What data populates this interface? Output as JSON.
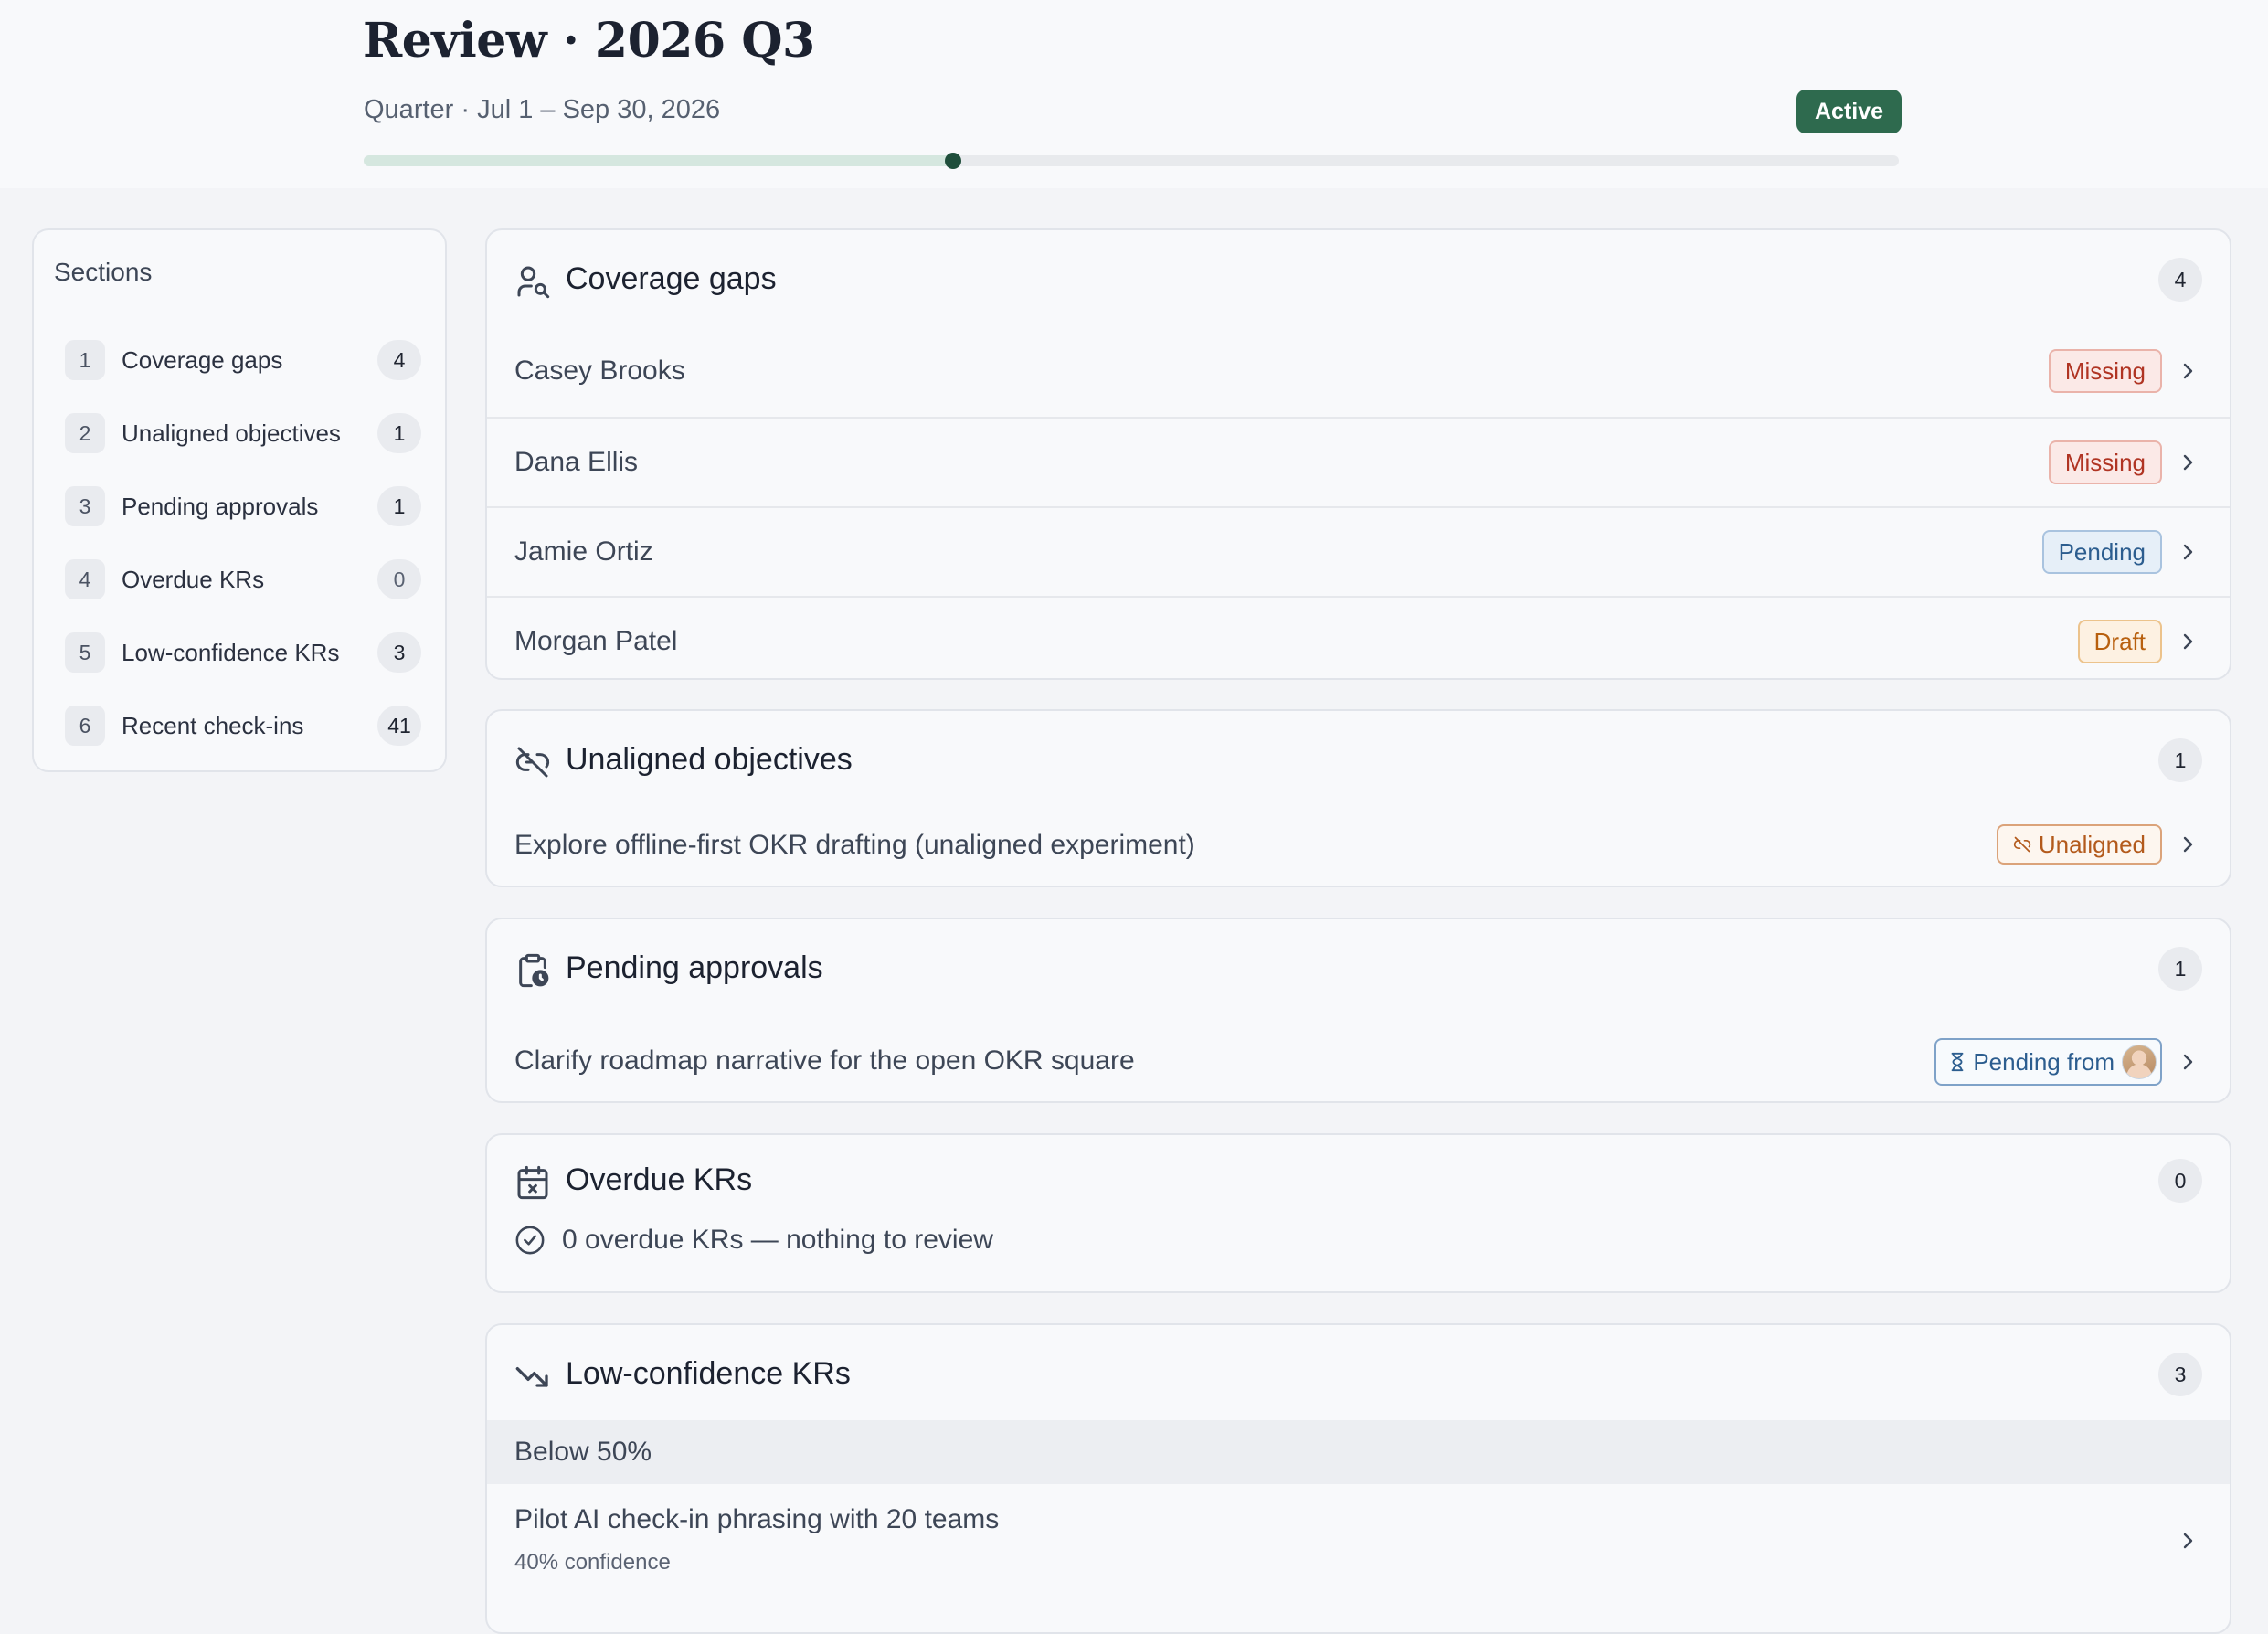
{
  "header": {
    "title": "Review · 2026 Q3",
    "subtitle": "Quarter · Jul 1 – Sep 30, 2026",
    "status": "Active",
    "status_color": "#2e6a4e",
    "progress_fraction": 0.384
  },
  "sidebar": {
    "heading": "Sections",
    "items": [
      {
        "index": "1",
        "label": "Coverage gaps",
        "count": "4"
      },
      {
        "index": "2",
        "label": "Unaligned objectives",
        "count": "1"
      },
      {
        "index": "3",
        "label": "Pending approvals",
        "count": "1"
      },
      {
        "index": "4",
        "label": "Overdue KRs",
        "count": "0"
      },
      {
        "index": "5",
        "label": "Low-confidence KRs",
        "count": "3"
      },
      {
        "index": "6",
        "label": "Recent check-ins",
        "count": "41"
      }
    ]
  },
  "coverage": {
    "title": "Coverage gaps",
    "icon": "user-search-icon",
    "count": "4",
    "rows": [
      {
        "name": "Casey Brooks",
        "status": "Missing"
      },
      {
        "name": "Dana Ellis",
        "status": "Missing"
      },
      {
        "name": "Jamie Ortiz",
        "status": "Pending"
      },
      {
        "name": "Morgan Patel",
        "status": "Draft"
      }
    ]
  },
  "unaligned": {
    "title": "Unaligned objectives",
    "icon": "unlink-icon",
    "count": "1",
    "rows": [
      {
        "name": "Explore offline-first OKR drafting (unaligned experiment)",
        "status": "Unaligned"
      }
    ]
  },
  "approvals": {
    "title": "Pending approvals",
    "icon": "clipboard-clock-icon",
    "count": "1",
    "rows": [
      {
        "name": "Clarify roadmap narrative for the open OKR square",
        "status": "Pending from"
      }
    ]
  },
  "overdue": {
    "title": "Overdue KRs",
    "icon": "calendar-x-icon",
    "count": "0",
    "empty_text": "0 overdue KRs — nothing to review"
  },
  "lowconf": {
    "title": "Low-confidence KRs",
    "icon": "trending-down-icon",
    "count": "3",
    "group_label": "Below 50%",
    "rows": [
      {
        "name": "Pilot AI check-in phrasing with 20 teams",
        "meta": "40% confidence"
      }
    ]
  }
}
